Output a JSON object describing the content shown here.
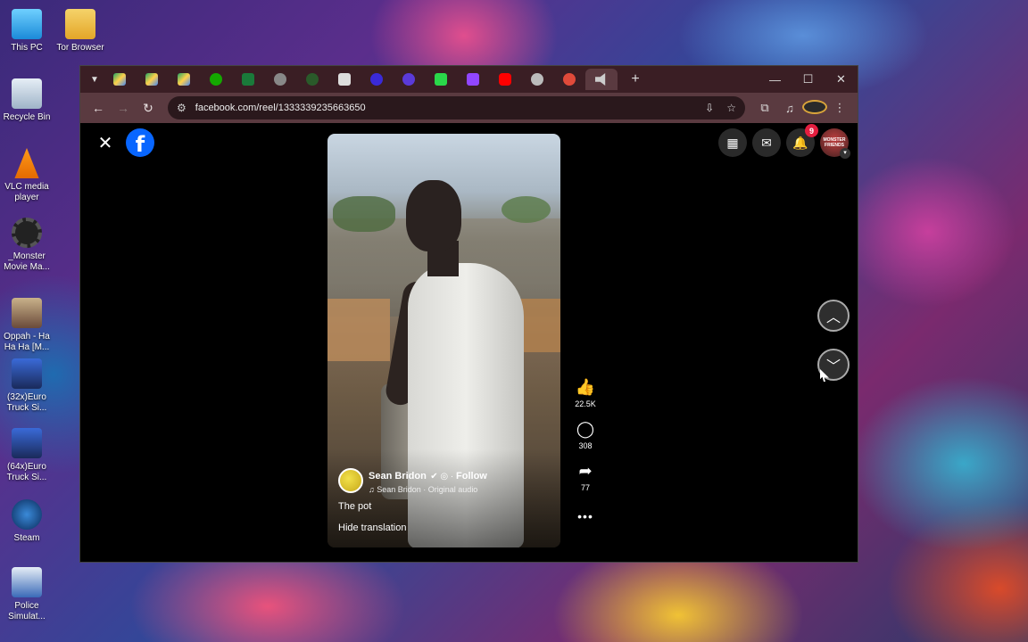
{
  "desktop": {
    "icons": [
      {
        "label": "This PC"
      },
      {
        "label": "Tor Browser"
      },
      {
        "label": "Recycle Bin"
      },
      {
        "label": "VLC media player"
      },
      {
        "label": "_Monster Movie Ma..."
      },
      {
        "label": "Oppah - Ha Ha Ha [M..."
      },
      {
        "label": "(32x)Euro Truck Si..."
      },
      {
        "label": "(64x)Euro Truck Si..."
      },
      {
        "label": "Steam"
      },
      {
        "label": "Police Simulat..."
      }
    ]
  },
  "browser": {
    "address": "facebook.com/reel/1333339235663650",
    "nav": {
      "back": "←",
      "forward": "→",
      "reload": "↻"
    },
    "tab_new": "+",
    "window": {
      "minimize": "—",
      "maximize": "☐",
      "close": "✕"
    }
  },
  "page": {
    "close": "✕",
    "logo": "f",
    "notifications_count": "9",
    "avatar_text": "MONSTER FRIENDS"
  },
  "reel": {
    "author_name": "Sean Bridon",
    "follow_label": "Follow",
    "audio": "♫ Sean Bridon · Original audio",
    "caption": "The pot",
    "hide_translation": "Hide translation",
    "likes": "22.5K",
    "comments": "308",
    "shares": "77",
    "more": "•••"
  },
  "colors": {
    "facebook_blue": "#0866ff",
    "badge_red": "#e41e3f",
    "tab_bar": "#3a1e24",
    "toolbar": "#5a3a40"
  }
}
